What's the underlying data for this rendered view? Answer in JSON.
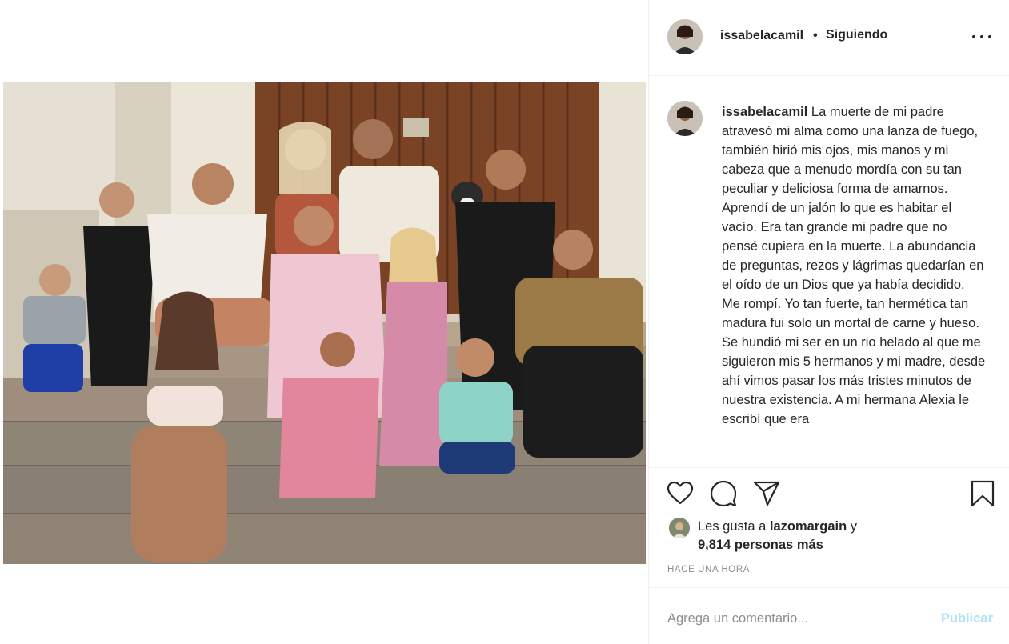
{
  "post": {
    "photo_icon": "family-photo"
  },
  "header": {
    "username": "issabelacamil",
    "dot": "•",
    "follow_status": "Siguiendo",
    "more_icon": "more-horizontal-icon"
  },
  "caption": {
    "username": "issabelacamil",
    "text": "La muerte de mi padre atravesó mi alma como una lanza de fuego, también hirió mis ojos, mis manos y mi cabeza que a menudo mordía con su tan peculiar y deliciosa forma de amarnos. Aprendí de un jalón lo que es habitar el vacío. Era tan grande mi padre que no pensé cupiera en la muerte. La abundancia de preguntas, rezos y lágrimas quedarían en el oído de un Dios que ya había decidido. Me rompí. Yo tan fuerte, tan hermética tan madura fui solo un mortal de carne y hueso. Se hundió mi ser en un rio helado al que me siguieron mis 5 hermanos y mi madre, desde ahí vimos pasar los más tristes minutos de nuestra existencia. A mi hermana Alexia le escribí que era"
  },
  "actions": {
    "like_icon": "heart-icon",
    "comment_icon": "comment-icon",
    "share_icon": "paper-plane-icon",
    "save_icon": "bookmark-icon"
  },
  "likes": {
    "prefix": "Les gusta a",
    "liked_by": "lazomargain",
    "conjunction": "y",
    "others": "9,814 personas más"
  },
  "timestamp": "Hace una hora",
  "comment_box": {
    "placeholder": "Agrega un comentario...",
    "publish_label": "Publicar",
    "publish_color": "#b2dffc"
  }
}
